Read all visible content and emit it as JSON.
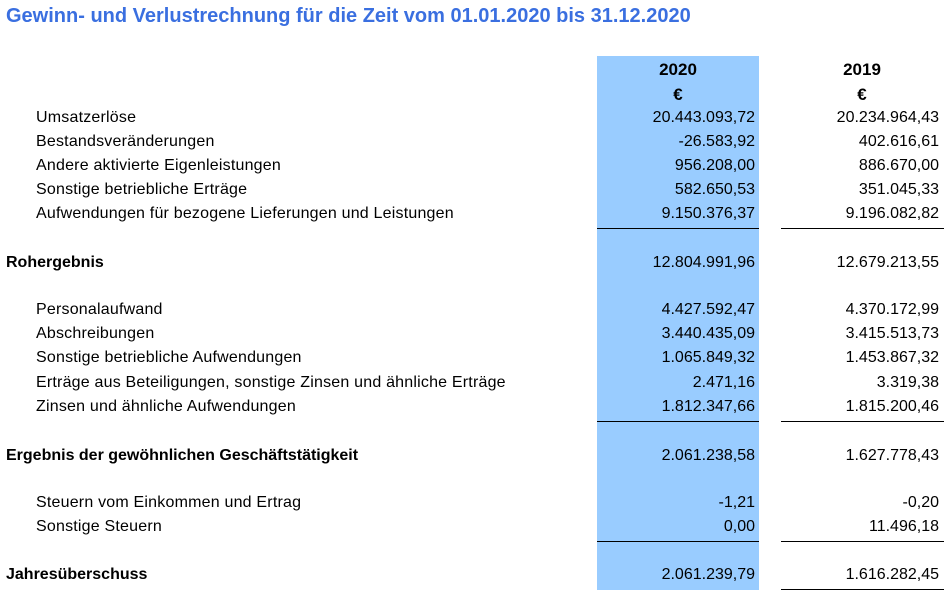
{
  "title": "Gewinn- und Verlustrechnung für die Zeit vom 01.01.2020 bis 31.12.2020",
  "columns": [
    {
      "year": "2020",
      "currency": "€"
    },
    {
      "year": "2019",
      "currency": "€"
    }
  ],
  "rows": [
    {
      "label": "Umsatzerlöse",
      "v2020": "20.443.093,72",
      "v2019": "20.234.964,43"
    },
    {
      "label": "Bestandsveränderungen",
      "v2020": "-26.583,92",
      "v2019": "402.616,61"
    },
    {
      "label": "Andere aktivierte Eigenleistungen",
      "v2020": "956.208,00",
      "v2019": "886.670,00"
    },
    {
      "label": "Sonstige betriebliche Erträge",
      "v2020": "582.650,53",
      "v2019": "351.045,33"
    },
    {
      "label": "Aufwendungen für bezogene Lieferungen und Leistungen",
      "v2020": "9.150.376,37",
      "v2019": "9.196.082,82"
    },
    {
      "label": "Rohergebnis",
      "v2020": "12.804.991,96",
      "v2019": "12.679.213,55"
    },
    {
      "label": "Personalaufwand",
      "v2020": "4.427.592,47",
      "v2019": "4.370.172,99"
    },
    {
      "label": "Abschreibungen",
      "v2020": "3.440.435,09",
      "v2019": "3.415.513,73"
    },
    {
      "label": "Sonstige betriebliche Aufwendungen",
      "v2020": "1.065.849,32",
      "v2019": "1.453.867,32"
    },
    {
      "label": "Erträge aus Beteiligungen, sonstige Zinsen und ähnliche Erträge",
      "v2020": "2.471,16",
      "v2019": "3.319,38"
    },
    {
      "label": "Zinsen und ähnliche Aufwendungen",
      "v2020": "1.812.347,66",
      "v2019": "1.815.200,46"
    },
    {
      "label": "Ergebnis der gewöhnlichen Geschäftstätigkeit",
      "v2020": "2.061.238,58",
      "v2019": "1.627.778,43"
    },
    {
      "label": "Steuern vom Einkommen und Ertrag",
      "v2020": "-1,21",
      "v2019": "-0,20"
    },
    {
      "label": "Sonstige Steuern",
      "v2020": "0,00",
      "v2019": "11.496,18"
    },
    {
      "label": "Jahresüberschuss",
      "v2020": "2.061.239,79",
      "v2019": "1.616.282,45"
    }
  ],
  "colors": {
    "title": "#3a6fe0",
    "highlight": "#99ccff"
  }
}
